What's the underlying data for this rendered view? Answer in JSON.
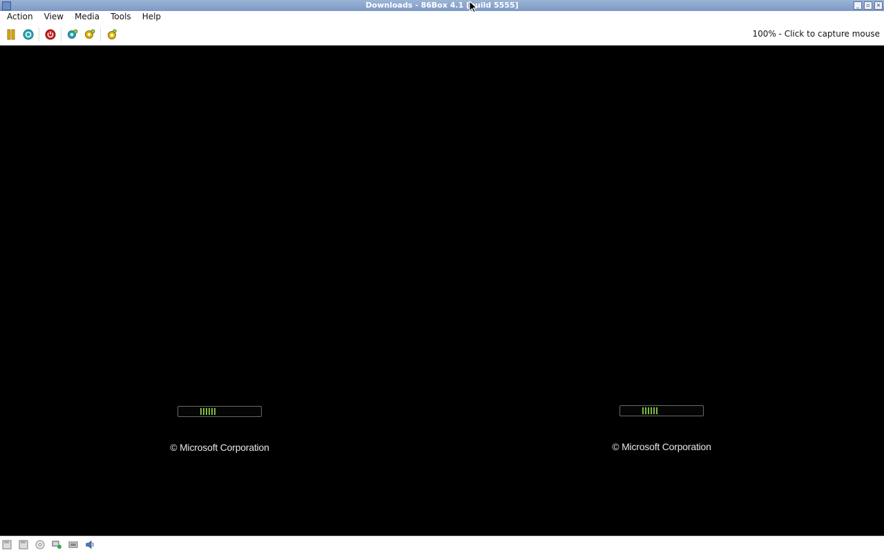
{
  "window": {
    "title": "Downloads - 86Box 4.1 [build 5555]",
    "controls": [
      "minimize",
      "restore",
      "close"
    ]
  },
  "menubar": {
    "items": [
      {
        "label": "Action"
      },
      {
        "label": "View"
      },
      {
        "label": "Media"
      },
      {
        "label": "Tools"
      },
      {
        "label": "Help"
      }
    ]
  },
  "toolbar": {
    "buttons": [
      {
        "name": "pause-icon",
        "color": "#e0a800"
      },
      {
        "name": "ctrl-alt-del-icon",
        "color": "#2aa7b8"
      },
      {
        "name": "power-icon",
        "color": "#cc1e1e"
      },
      {
        "name": "settings-icon",
        "color": "#2aa7b8"
      },
      {
        "name": "hard-reset-icon",
        "color": "#e0b800"
      },
      {
        "name": "screenshot-icon",
        "color": "#e0b800"
      }
    ],
    "status": "100% - Click to capture mouse"
  },
  "screen": {
    "background": "#000000",
    "boot_screens": [
      {
        "copyright": "© Microsoft Corporation"
      },
      {
        "copyright": "© Microsoft Corporation"
      }
    ],
    "progress_color": "#7fbf3a"
  },
  "statusbar": {
    "icons": [
      "floppy-icon",
      "floppy-icon",
      "cdrom-icon",
      "network-icon",
      "hard-disk-icon",
      "sound-icon"
    ]
  }
}
